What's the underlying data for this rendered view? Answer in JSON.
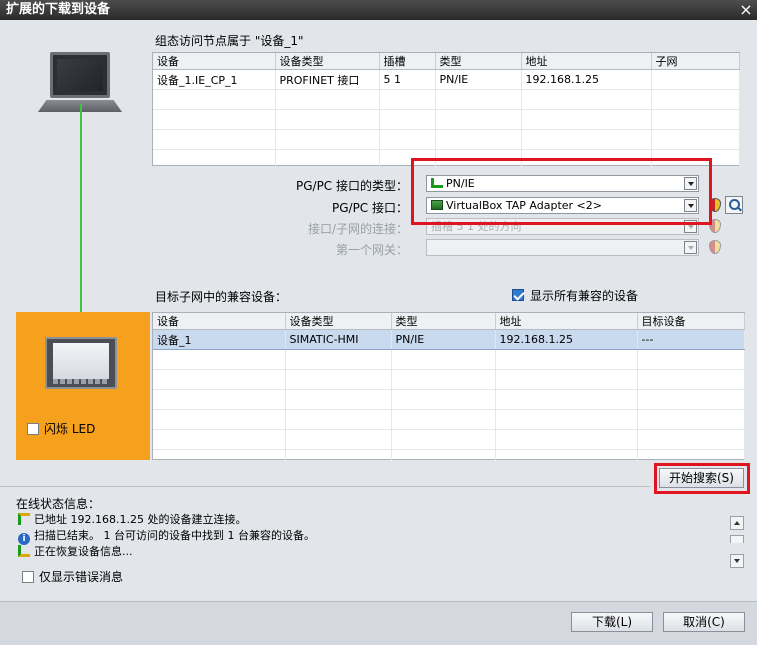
{
  "window": {
    "title": "扩展的下载到设备",
    "close_label": "×"
  },
  "config_section": {
    "caption": "组态访问节点属于 \"设备_1\"",
    "columns": [
      "设备",
      "设备类型",
      "插槽",
      "类型",
      "地址",
      "子网"
    ],
    "rows": [
      [
        "设备_1.IE_CP_1",
        "PROFINET 接口",
        "5 1",
        "PN/IE",
        "192.168.1.25",
        ""
      ]
    ]
  },
  "pg_pc": {
    "type_label": "PG/PC 接口的类型：",
    "type_value": "PN/IE",
    "interface_label": "PG/PC 接口：",
    "interface_value": "VirtualBox TAP Adapter <2>",
    "subnet_label": "接口/子网的连接：",
    "subnet_value": "插槽 5 1 处的方向",
    "gateway_label": "第一个网关：",
    "gateway_value": ""
  },
  "compatible_section": {
    "caption": "目标子网中的兼容设备：",
    "show_all_label": "显示所有兼容的设备",
    "show_all_checked": true,
    "columns": [
      "设备",
      "设备类型",
      "类型",
      "地址",
      "目标设备"
    ],
    "rows": [
      [
        "设备_1",
        "SIMATIC-HMI",
        "PN/IE",
        "192.168.1.25",
        "---"
      ]
    ]
  },
  "hmi": {
    "flash_led_label": "闪烁 LED"
  },
  "search_button_label": "开始搜索(S)",
  "status": {
    "caption": "在线状态信息：",
    "lines": [
      "已地址 192.168.1.25 处的设备建立连接。",
      "扫描已结束。 1 台可访问的设备中找到 1 台兼容的设备。",
      "正在恢复设备信息..."
    ],
    "only_errors_label": "仅显示错误消息"
  },
  "footer": {
    "download_label": "下载(L)",
    "cancel_label": "取消(C)"
  },
  "colors": {
    "accent_orange": "#f5a11d",
    "link_green": "#3ec43e",
    "highlight_red": "#e0141e",
    "selected_row": "#c9d9ee"
  }
}
